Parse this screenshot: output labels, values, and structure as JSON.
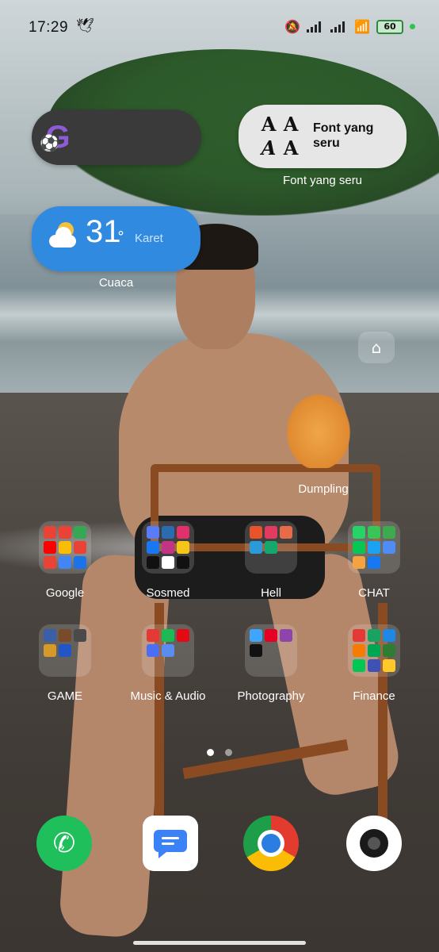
{
  "status_bar": {
    "time": "17:29",
    "battery": "60",
    "icons": [
      "notification-bird-icon",
      "mute-icon",
      "signal-icon",
      "signal-icon",
      "wifi-icon",
      "battery-icon",
      "charging-icon"
    ]
  },
  "widgets": {
    "font": {
      "title": "Font yang seru",
      "glyphs": [
        "A",
        "A",
        "A",
        "A"
      ],
      "caption": "Font yang seru"
    },
    "weather": {
      "temperature": "31",
      "degree_symbol": "°",
      "location": "Karet",
      "caption": "Cuaca"
    },
    "home_widget_caption": "Dumpling"
  },
  "folders": [
    {
      "label": "Google",
      "app_colors": [
        "#ea4335",
        "#ea4335",
        "#34a853",
        "#ff0000",
        "#fbbc05",
        "#ea4335",
        "#ea4335",
        "#4285f4",
        "#1a73e8"
      ]
    },
    {
      "label": "Sosmed",
      "app_colors": [
        "#5b7cfa",
        "#2b6cb0",
        "#e1306c",
        "#1877f2",
        "#c13584",
        "#f5c518",
        "#111111",
        "#ffffff",
        "#111111"
      ]
    },
    {
      "label": "Hell",
      "app_colors": [
        "#e8532b",
        "#e23b5f",
        "#e96a47",
        "#2a9ad8",
        "#14a86e",
        "#00000000",
        "#00000000",
        "#00000000",
        "#00000000"
      ]
    },
    {
      "label": "CHAT",
      "app_colors": [
        "#25d366",
        "#38c456",
        "#3daa4e",
        "#06c755",
        "#1da1f2",
        "#4e8df6",
        "#f4a340",
        "#1877f2",
        "#00000000"
      ]
    },
    {
      "label": "GAME",
      "app_colors": [
        "#3a5ea8",
        "#7a4b2a",
        "#4a4a4a",
        "#d59a2a",
        "#2255c6",
        "#00000000",
        "#00000000",
        "#00000000",
        "#00000000"
      ]
    },
    {
      "label": "Music & Audio",
      "app_colors": [
        "#e53935",
        "#1db954",
        "#e50914",
        "#4c6ef5",
        "#5b8def",
        "#00000000",
        "#00000000",
        "#00000000",
        "#00000000"
      ]
    },
    {
      "label": "Photography",
      "app_colors": [
        "#3ea6ff",
        "#e60023",
        "#8e44ad",
        "#111111",
        "#00000000",
        "#00000000",
        "#00000000",
        "#00000000",
        "#00000000"
      ]
    },
    {
      "label": "Finance",
      "app_colors": [
        "#e53935",
        "#1aa260",
        "#1e88e5",
        "#f57c00",
        "#00a651",
        "#2e7d32",
        "#00c853",
        "#3f51b5",
        "#ffca28"
      ]
    }
  ],
  "page_indicator": {
    "total": 2,
    "active": 1
  },
  "dock": [
    "phone-app",
    "messages-app",
    "chrome-app",
    "camera-app"
  ]
}
